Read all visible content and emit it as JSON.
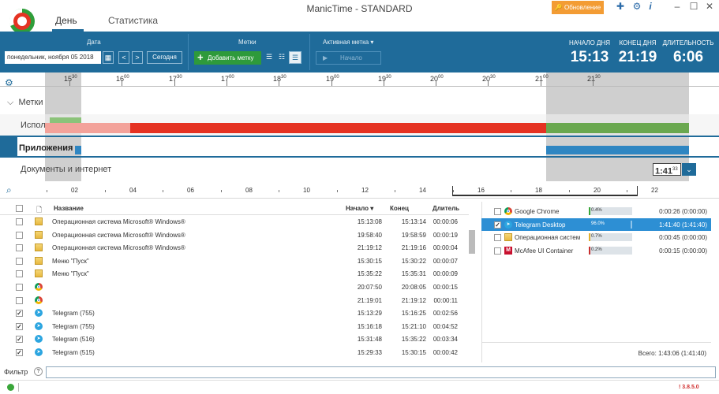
{
  "app": {
    "title": "ManicTime - STANDARD",
    "update_label": "Обновление",
    "tab_day": "День",
    "tab_stats": "Статистика",
    "minimize": "–",
    "maximize": "☐",
    "close": "✕",
    "help": "?",
    "info": "i"
  },
  "toolbar": {
    "date_label": "Дата",
    "date_value": "понедельник, ноября 05 2018",
    "today": "Сегодня",
    "prev": "<",
    "next": ">",
    "tags_label": "Метки",
    "add_tag": "Добавить метку",
    "active_tag_label": "Активная метка",
    "start": "Начало",
    "day_start_label": "НАЧАЛО ДНЯ",
    "day_start": "15:13",
    "day_end_label": "КОНЕЦ ДНЯ",
    "day_end": "21:19",
    "duration_label": "ДЛИТЕЛЬНОСТЬ",
    "duration": "6:06"
  },
  "timeline": {
    "hours": [
      "15",
      "16",
      "17",
      "17",
      "18",
      "19",
      "19",
      "20",
      "20",
      "21",
      "21"
    ],
    "hour_sups": [
      "30",
      "00",
      "30",
      "00",
      "30",
      "00",
      "30",
      "00",
      "30",
      "00",
      "30"
    ],
    "rows": {
      "tags": "Метки",
      "computer": "Использование компьютера",
      "apps": "Приложения",
      "docs": "Документы и интернет"
    },
    "zoom_value": "1:41",
    "zoom_sup": "33"
  },
  "axis": {
    "ticks": [
      "02",
      "04",
      "06",
      "08",
      "10",
      "12",
      "14",
      "16",
      "18",
      "20",
      "22"
    ]
  },
  "table": {
    "headers": {
      "name": "Название",
      "start": "Начало",
      "end": "Конец",
      "duration": "Длитель"
    },
    "rows": [
      {
        "checked": false,
        "icon": "windows-folder",
        "name": "Операционная система Microsoft® Windows®",
        "start": "15:13:08",
        "end": "15:13:14",
        "duration": "00:00:06"
      },
      {
        "checked": false,
        "icon": "windows-folder",
        "name": "Операционная система Microsoft® Windows®",
        "start": "19:58:40",
        "end": "19:58:59",
        "duration": "00:00:19"
      },
      {
        "checked": false,
        "icon": "windows-folder",
        "name": "Операционная система Microsoft® Windows®",
        "start": "21:19:12",
        "end": "21:19:16",
        "duration": "00:00:04"
      },
      {
        "checked": false,
        "icon": "windows-folder",
        "name": "Меню \"Пуск\"",
        "start": "15:30:15",
        "end": "15:30:22",
        "duration": "00:00:07"
      },
      {
        "checked": false,
        "icon": "windows-folder",
        "name": "Меню \"Пуск\"",
        "start": "15:35:22",
        "end": "15:35:31",
        "duration": "00:00:09"
      },
      {
        "checked": false,
        "icon": "chrome",
        "name": "",
        "start": "20:07:50",
        "end": "20:08:05",
        "duration": "00:00:15"
      },
      {
        "checked": false,
        "icon": "chrome",
        "name": "",
        "start": "21:19:01",
        "end": "21:19:12",
        "duration": "00:00:11"
      },
      {
        "checked": true,
        "icon": "telegram",
        "name": "Telegram (755)",
        "start": "15:13:29",
        "end": "15:16:25",
        "duration": "00:02:56"
      },
      {
        "checked": true,
        "icon": "telegram",
        "name": "Telegram (755)",
        "start": "15:16:18",
        "end": "15:21:10",
        "duration": "00:04:52"
      },
      {
        "checked": true,
        "icon": "telegram",
        "name": "Telegram (516)",
        "start": "15:31:48",
        "end": "15:35:22",
        "duration": "00:03:34"
      },
      {
        "checked": true,
        "icon": "telegram",
        "name": "Telegram (515)",
        "start": "15:29:33",
        "end": "15:30:15",
        "duration": "00:00:42"
      }
    ]
  },
  "apps": {
    "rows": [
      {
        "checked": false,
        "icon": "chrome",
        "name": "Google Chrome",
        "pct_label": "0.4%",
        "pct": 0.004,
        "time": "0:00:26 (0:00:00)",
        "color": "#3aa63a"
      },
      {
        "checked": true,
        "icon": "telegram",
        "name": "Telegram Desktop",
        "pct_label": "96.0%",
        "pct": 0.96,
        "time": "1:41:40 (1:41:40)",
        "color": "#2d8fd4",
        "selected": true
      },
      {
        "checked": false,
        "icon": "windows-folder",
        "name": "Операционная систем",
        "pct_label": "0.7%",
        "pct": 0.007,
        "time": "0:00:45 (0:00:00)",
        "color": "#e0b030"
      },
      {
        "checked": false,
        "icon": "mcafee",
        "name": "McAfee UI Container",
        "pct_label": "0.2%",
        "pct": 0.002,
        "time": "0:00:15 (0:00:00)",
        "color": "#c83030"
      }
    ],
    "total": "Всего: 1:43:06 (1:41:40)"
  },
  "filter": {
    "label": "Фильтр",
    "help": "?",
    "value": ""
  },
  "status": {
    "version": "! 3.8.5.0"
  },
  "colors": {
    "accent": "#1f6b9a",
    "red": "#e53222",
    "green": "#6aa84f",
    "blue": "#2f86c2"
  }
}
